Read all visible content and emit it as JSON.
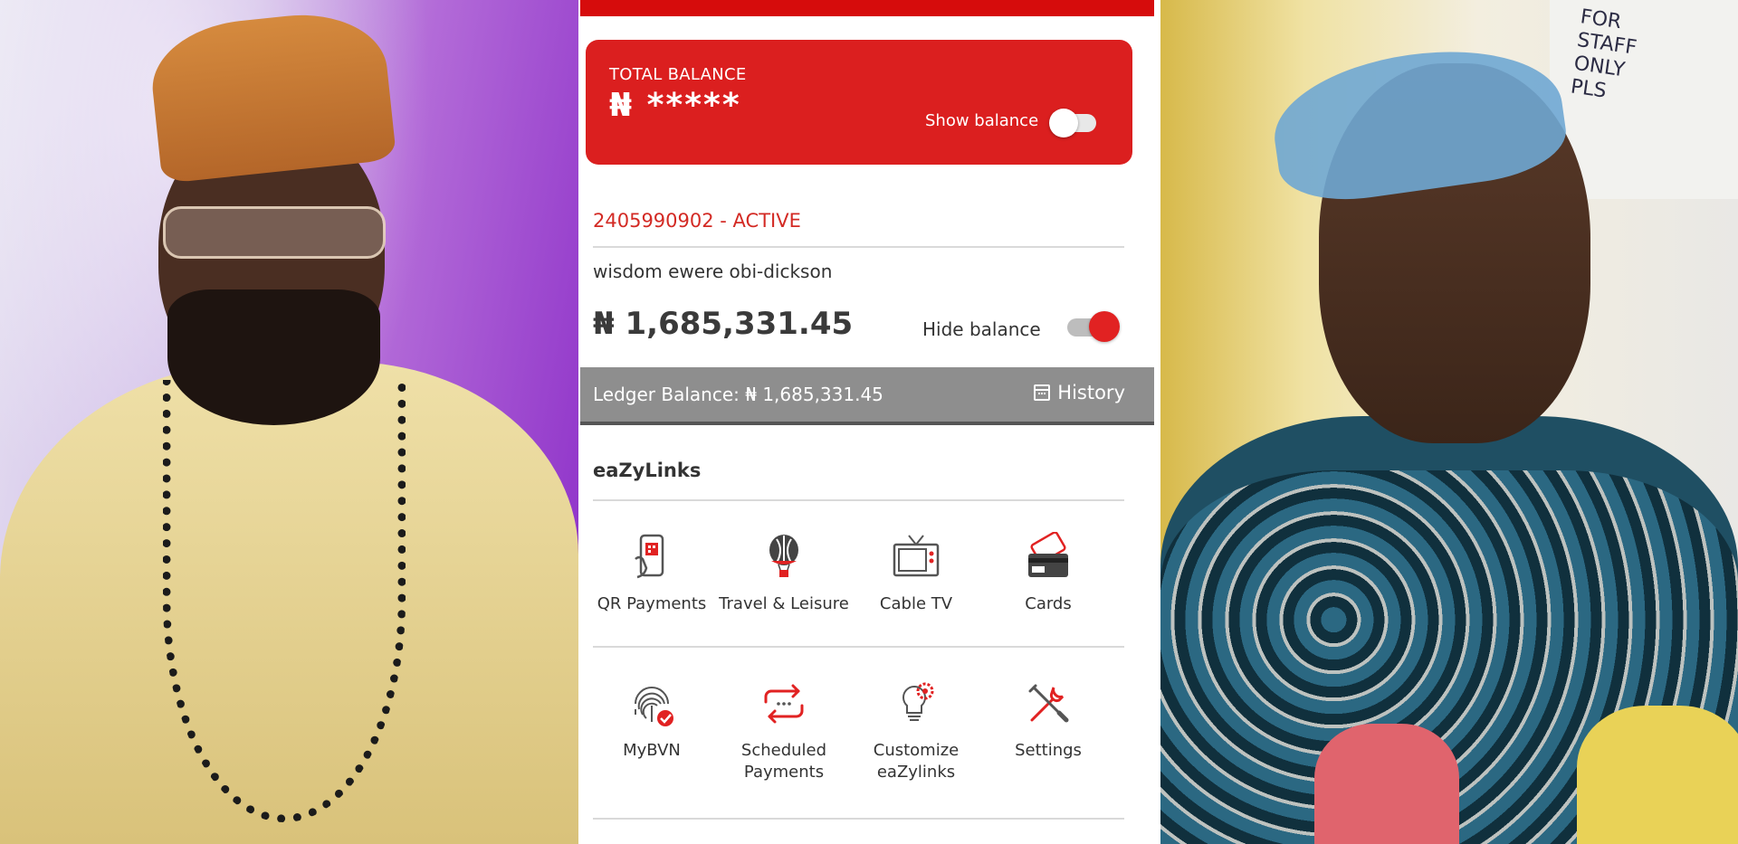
{
  "photos": {
    "left_alt": "Man in cream agbada, orange cap, clear glasses and bead necklace",
    "right_alt": "Woman in hospital bed wearing blue hair net, microphones in foreground",
    "right_sign_text": "FOR\nSTAFF\nONLY\nPLS"
  },
  "balance_card": {
    "label": "TOTAL BALANCE",
    "masked_value": "₦ *****",
    "show_balance_label": "Show balance",
    "show_balance_on": false
  },
  "account": {
    "number_status": "2405990902  - ACTIVE",
    "holder_name": "wisdom ewere obi-dickson",
    "balance": "₦ 1,685,331.45",
    "hide_balance_label": "Hide balance",
    "hide_balance_on": true
  },
  "ledger": {
    "text": "Ledger Balance: ₦ 1,685,331.45",
    "history_label": "History"
  },
  "eazylinks": {
    "title": "eaZyLinks",
    "row1": [
      {
        "label": "QR Payments",
        "icon": "qr-phone-icon"
      },
      {
        "label": "Travel & Leisure",
        "icon": "balloon-icon"
      },
      {
        "label": "Cable TV",
        "icon": "tv-icon"
      },
      {
        "label": "Cards",
        "icon": "cards-icon"
      }
    ],
    "row2": [
      {
        "label": "MyBVN",
        "icon": "fingerprint-icon"
      },
      {
        "label": "Scheduled Payments",
        "icon": "repeat-arrows-icon"
      },
      {
        "label": "Customize eaZylinks",
        "icon": "bulb-gear-icon"
      },
      {
        "label": "Settings",
        "icon": "tools-icon"
      }
    ]
  },
  "colors": {
    "brand_red": "#db1f1f",
    "ledger_gray": "#8e8e8e"
  }
}
